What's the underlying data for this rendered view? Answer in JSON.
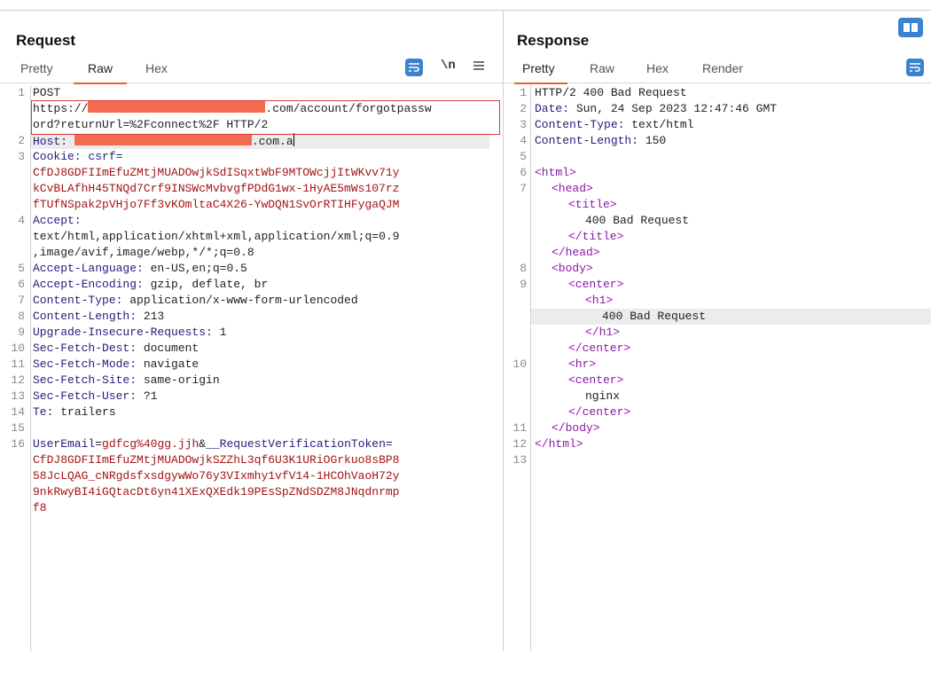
{
  "request": {
    "title": "Request",
    "tabs": [
      "Pretty",
      "Raw",
      "Hex"
    ],
    "active_tab": "Raw",
    "newline_label": "\\n",
    "line_numbers": [
      "1",
      "",
      "",
      "2",
      "3",
      "",
      "",
      "",
      "4",
      "",
      "",
      "5",
      "6",
      "7",
      "8",
      "9",
      "10",
      "11",
      "12",
      "13",
      "14",
      "15",
      "16",
      "",
      "",
      "",
      "",
      ""
    ],
    "lines": {
      "l1": "POST",
      "l1b_pre": "https://",
      "l1b_post": ".com/account/forgotpassw",
      "l1c": "ord?returnUrl=%2Fconnect%2F HTTP/2",
      "l2_key": "Host: ",
      "l2_post": ".com.a",
      "l3_key": "Cookie: csrf=",
      "l3a": "CfDJ8GDFIImEfuZMtjMUADOwjkSdISqxtWbF9MTOWcjjItWKvv71y",
      "l3b": "kCvBLAfhH45TNQd7Crf9INSWcMvbvgfPDdG1wx-1HyAE5mWs107rz",
      "l3c": "fTUfNSpak2pVHjo7Ff3vKOmltaC4X26-YwDQN1SvOrRTIHFygaQJM",
      "l4_key": "Accept: ",
      "l4a": "text/html,application/xhtml+xml,application/xml;q=0.9",
      "l4b": ",image/avif,image/webp,*/*;q=0.8",
      "l5_key": "Accept-Language: ",
      "l5_val": "en-US,en;q=0.5",
      "l6_key": "Accept-Encoding: ",
      "l6_val": "gzip, deflate, br",
      "l7_key": "Content-Type: ",
      "l7_val": "application/x-www-form-urlencoded",
      "l8_key": "Content-Length: ",
      "l8_val": "213",
      "l9_key": "Upgrade-Insecure-Requests: ",
      "l9_val": "1",
      "l10_key": "Sec-Fetch-Dest: ",
      "l10_val": "document",
      "l11_key": "Sec-Fetch-Mode: ",
      "l11_val": "navigate",
      "l12_key": "Sec-Fetch-Site: ",
      "l12_val": "same-origin",
      "l13_key": "Sec-Fetch-User: ",
      "l13_val": "?1",
      "l14_key": "Te: ",
      "l14_val": "trailers",
      "l16_key1": "UserEmail",
      "l16_eq1": "=",
      "l16_val1": "gdfcg%40gg.jjh",
      "l16_amp": "&",
      "l16_key2": "__RequestVerificationToken",
      "l16_eq2": "=",
      "l16a": "CfDJ8GDFIImEfuZMtjMUADOwjkSZZhL3qf6U3K1URiOGrkuo8sBP8",
      "l16b": "58JcLQAG_cNRgdsfxsdgywWo76y3VIxmhy1vfV14-1HCOhVaoH72y",
      "l16c": "9nkRwyBI4iGQtacDt6yn41XExQXEdk19PEsSpZNdSDZM8JNqdnrmp",
      "l16d": "f8"
    }
  },
  "response": {
    "title": "Response",
    "tabs": [
      "Pretty",
      "Raw",
      "Hex",
      "Render"
    ],
    "active_tab": "Pretty",
    "line_numbers": [
      "1",
      "2",
      "3",
      "4",
      "5",
      "6",
      "7",
      "",
      "",
      "",
      "",
      "8",
      "9",
      "",
      "",
      "",
      "",
      "10",
      "",
      "",
      "",
      "11",
      "12",
      "13"
    ],
    "lines": {
      "r1": "HTTP/2 400 Bad Request",
      "r2_key": "Date: ",
      "r2_val": "Sun, 24 Sep 2023 12:47:46 GMT",
      "r3_key": "Content-Type: ",
      "r3_val": "text/html",
      "r4_key": "Content-Length: ",
      "r4_val": "150",
      "r6": "<html>",
      "r7": "<head>",
      "r7a": "<title>",
      "r7b": "400 Bad Request",
      "r7c": "</title>",
      "r7d": "</head>",
      "r8": "<body>",
      "r9": "<center>",
      "r9a": "<h1>",
      "r9b": "400 Bad Request",
      "r9c": "</h1>",
      "r9d": "</center>",
      "r10": "<hr>",
      "r10a": "<center>",
      "r10b": "nginx",
      "r10c": "</center>",
      "r11": "</body>",
      "r12": "</html>"
    }
  },
  "colors": {
    "accent": "#e8622c",
    "redaction": "#f36a4f",
    "highlight_box": "#d43f3a",
    "header_key": "#1f1f7a",
    "cookie_value": "#a31515",
    "html_tag": "#8a1aa3",
    "line_number": "#8a8a8a"
  },
  "icons": {
    "layout_toggle": "split-layout-icon",
    "wrap": "word-wrap-icon",
    "newline": "newline-toggle-icon",
    "menu": "hamburger-menu-icon"
  }
}
